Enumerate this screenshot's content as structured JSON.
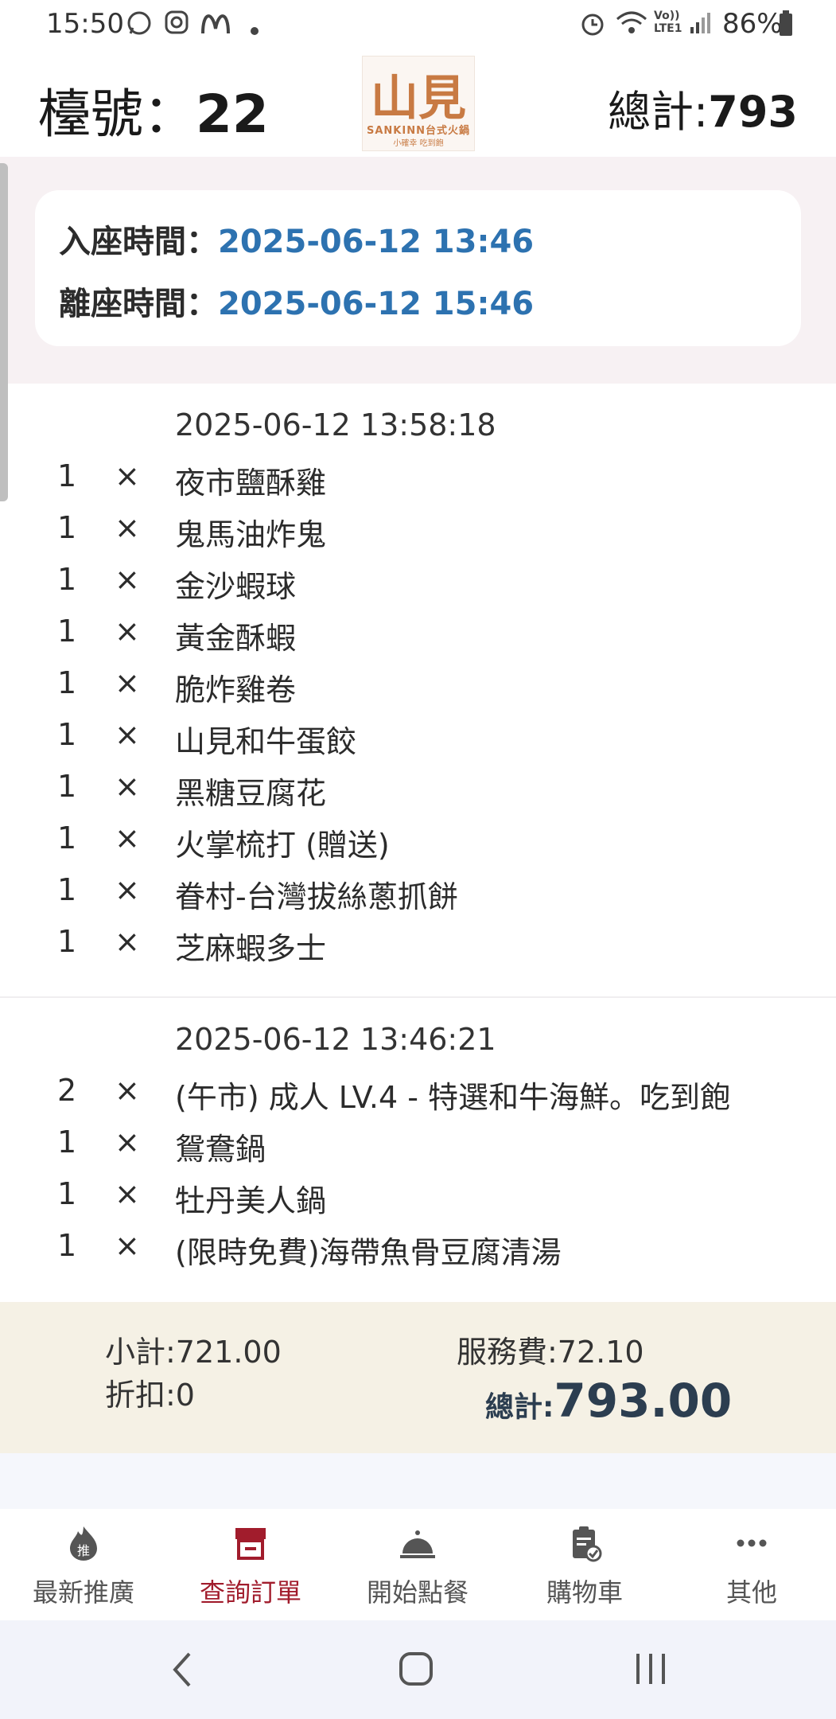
{
  "status_bar": {
    "time": "15:50",
    "battery": "86%",
    "icons": [
      "whatsapp-icon",
      "instagram-icon",
      "mcdonalds-icon",
      "alarm-icon",
      "wifi-icon",
      "volte-icon",
      "signal-icon",
      "battery-icon"
    ]
  },
  "header": {
    "table_label": "檯號：",
    "table_number": "22",
    "logo_text": "山見",
    "logo_en": "SANKINN台式火鍋",
    "logo_sub": "小確幸 吃到飽",
    "total_label": "總計:",
    "total_value": "793"
  },
  "time_card": {
    "checkin_label": "入座時間：",
    "checkin_value": "2025-06-12 13:46",
    "checkout_label": "離座時間：",
    "checkout_value": "2025-06-12 15:46"
  },
  "order_groups": [
    {
      "timestamp": "2025-06-12 13:58:18",
      "items": [
        {
          "qty": "1",
          "x": "×",
          "name": "夜市鹽酥雞"
        },
        {
          "qty": "1",
          "x": "×",
          "name": "鬼馬油炸鬼"
        },
        {
          "qty": "1",
          "x": "×",
          "name": "金沙蝦球"
        },
        {
          "qty": "1",
          "x": "×",
          "name": "黃金酥蝦"
        },
        {
          "qty": "1",
          "x": "×",
          "name": "脆炸雞卷"
        },
        {
          "qty": "1",
          "x": "×",
          "name": "山見和牛蛋餃"
        },
        {
          "qty": "1",
          "x": "×",
          "name": "黑糖豆腐花"
        },
        {
          "qty": "1",
          "x": "×",
          "name": "火掌梳打 (贈送)"
        },
        {
          "qty": "1",
          "x": "×",
          "name": "眷村-台灣拔絲蔥抓餅"
        },
        {
          "qty": "1",
          "x": "×",
          "name": "芝麻蝦多士"
        }
      ]
    },
    {
      "timestamp": "2025-06-12 13:46:21",
      "items": [
        {
          "qty": "2",
          "x": "×",
          "name": "(午市) 成人 LV.4 - 特選和牛海鮮。吃到飽"
        },
        {
          "qty": "1",
          "x": "×",
          "name": "鴛鴦鍋"
        },
        {
          "qty": "1",
          "x": "×",
          "name": "牡丹美人鍋"
        },
        {
          "qty": "1",
          "x": "×",
          "name": "(限時免費)海帶魚骨豆腐清湯"
        }
      ]
    }
  ],
  "summary": {
    "subtotal": "小計:721.00",
    "service_fee": "服務費:72.10",
    "discount": "折扣:0",
    "total_label": "總計:",
    "total_value": "793.00"
  },
  "bottom_nav": [
    {
      "label": "最新推廣",
      "icon": "promo-flame-icon",
      "active": false
    },
    {
      "label": "查詢訂單",
      "icon": "order-register-icon",
      "active": true
    },
    {
      "label": "開始點餐",
      "icon": "cloche-icon",
      "active": false
    },
    {
      "label": "購物車",
      "icon": "clipboard-check-icon",
      "active": false
    },
    {
      "label": "其他",
      "icon": "more-dots-icon",
      "active": false
    }
  ],
  "colors": {
    "accent": "#a11c2c",
    "time_value": "#2d72b0",
    "summary_bg": "#f5f1e5",
    "logo": "#c87a43"
  }
}
